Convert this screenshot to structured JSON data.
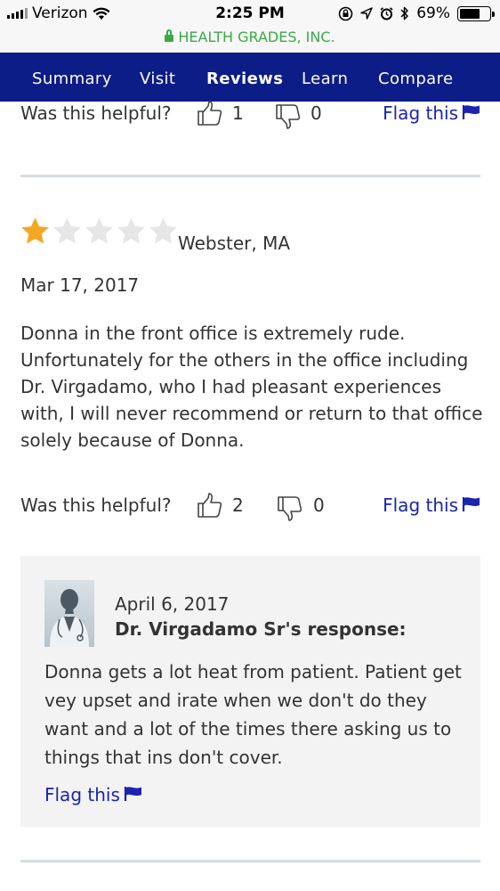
{
  "status_bar": {
    "carrier": "Verizon",
    "time": "2:25 PM",
    "battery_percent": "69%",
    "battery_level": 0.69,
    "icons": [
      "signal-icon",
      "wifi-icon",
      "lock-rotation-icon",
      "location-icon",
      "alarm-icon",
      "bluetooth-icon",
      "battery-icon"
    ]
  },
  "url_bar": {
    "domain": "HEALTH GRADES, INC.",
    "color": "#3aaa47"
  },
  "nav": {
    "tabs": [
      {
        "label": "Summary",
        "active": false
      },
      {
        "label": "Visit",
        "active": false
      },
      {
        "label": "Reviews",
        "active": true
      },
      {
        "label": "Learn",
        "active": false
      },
      {
        "label": "Compare",
        "active": false
      }
    ],
    "background": "#0c1d87"
  },
  "prev_review": {
    "helpful_label": "Was this helpful?",
    "up_count": "1",
    "down_count": "0",
    "flag_label": "Flag this"
  },
  "review": {
    "rating": 1,
    "max_rating": 5,
    "location": "Webster, MA",
    "date": "Mar 17, 2017",
    "text": "Donna in the front office is extremely rude. Unfortunately for the others in the office including Dr. Virgadamo, who I had pleasant experiences with, I will never recommend or return to that office solely because of Donna.",
    "helpful_label": "Was this helpful?",
    "up_count": "2",
    "down_count": "0",
    "flag_label": "Flag this"
  },
  "response": {
    "date": "April 6, 2017",
    "author": "Dr. Virgadamo Sr's response:",
    "text": "Donna gets a lot heat from patient. Patient get vey upset and irate when we don't do they want and a lot of the times there asking us to things that ins don't cover.",
    "flag_label": "Flag this"
  },
  "colors": {
    "link": "#1a24b0",
    "star_filled": "#f5a623",
    "star_empty": "#e6e6e6",
    "response_bg": "#f3f3f3"
  }
}
